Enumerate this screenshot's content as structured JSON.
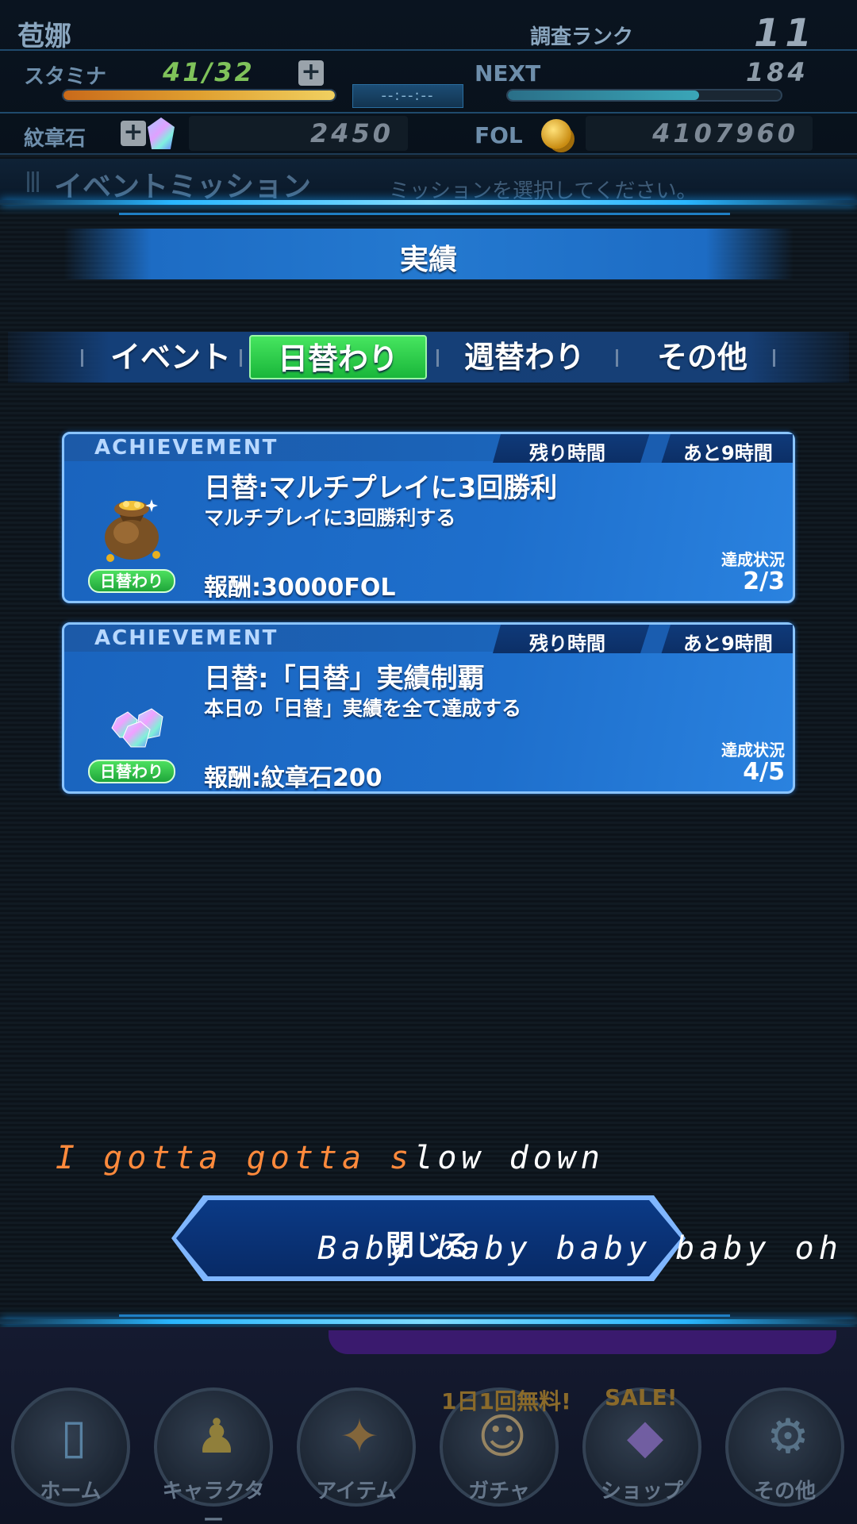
{
  "header": {
    "player_name": "苞娜",
    "rank_label": "調査ランク",
    "rank_value": "11",
    "stamina_label": "スタミナ",
    "stamina_value": "41/32",
    "stamina_fill": 1.0,
    "stamina_timer": "--:--:--",
    "next_label": "NEXT",
    "next_value": "184",
    "next_fill": 0.7,
    "crest_label": "紋章石",
    "crest_value": "2450",
    "fol_label": "FOL",
    "fol_value": "4107960",
    "plus_symbol": "+"
  },
  "mission_bar": {
    "title": "イベントミッション",
    "hint": "ミッションを選択してください。"
  },
  "section": {
    "title": "実績"
  },
  "tabs": [
    {
      "label": "イベント",
      "active": false
    },
    {
      "label": "日替わり",
      "active": true
    },
    {
      "label": "週替わり",
      "active": false
    },
    {
      "label": "その他",
      "active": false
    }
  ],
  "cards": [
    {
      "tag": "ACHIEVEMENT",
      "remaining_label": "残り時間",
      "remaining_value": "あと9時間",
      "title": "日替:マルチプレイに3回勝利",
      "description": "マルチプレイに3回勝利する",
      "reward": "報酬:30000FOL",
      "progress_label": "達成状況",
      "progress": "2/3",
      "badge": "日替わり",
      "icon": "gold-bag-icon"
    },
    {
      "tag": "ACHIEVEMENT",
      "remaining_label": "残り時間",
      "remaining_value": "あと9時間",
      "title": "日替:「日替」実績制覇",
      "description": "本日の「日替」実績を全て達成する",
      "reward": "報酬:紋章石200",
      "progress_label": "達成状況",
      "progress": "4/5",
      "badge": "日替わり",
      "icon": "crest-gem-icon"
    }
  ],
  "close_button": {
    "label": "閉じる"
  },
  "lyrics": {
    "line1_highlight": "I gotta gotta s",
    "line1_rest": "low down",
    "line2": "Baby baby baby baby oh"
  },
  "nav": {
    "items": [
      {
        "label": "ホーム",
        "icon": "home-door-icon"
      },
      {
        "label": "キャラクター",
        "icon": "character-group-icon"
      },
      {
        "label": "アイテム",
        "icon": "item-bag-icon"
      },
      {
        "label": "ガチャ",
        "icon": "gacha-character-icon",
        "promo": "1日1回無料!"
      },
      {
        "label": "ショップ",
        "icon": "shop-gem-icon",
        "promo": "SALE!"
      },
      {
        "label": "その他",
        "icon": "settings-gear-icon"
      }
    ]
  },
  "colors": {
    "accent_blue": "#1e6fcc",
    "tab_active_green": "#2bc94a",
    "stamina_orange": "#e0a030",
    "next_teal": "#3aa6b8",
    "lyric_orange": "#ff8a3c"
  }
}
